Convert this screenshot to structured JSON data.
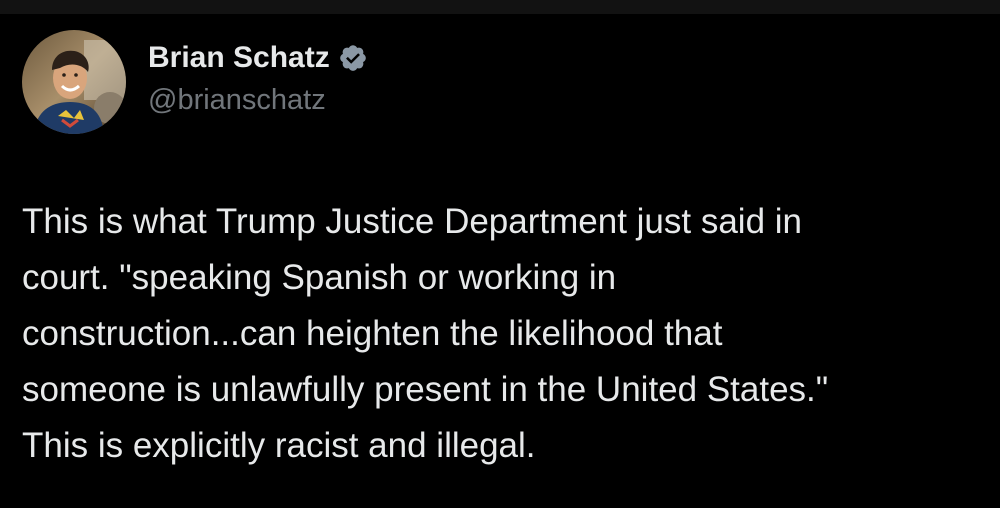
{
  "author": {
    "display_name": "Brian Schatz",
    "handle": "@brianschatz",
    "verified": true,
    "verified_color": "#8b98a5"
  },
  "tweet": {
    "text": "This is what Trump Justice Department just said in\ncourt.  \"speaking Spanish or working in\nconstruction...can heighten the likelihood that\nsomeone is unlawfully present in the United States.\"\nThis is explicitly racist and illegal."
  },
  "icons": {
    "verified": "verified-badge-icon",
    "avatar": "profile-photo"
  },
  "colors": {
    "background": "#000000",
    "text_primary": "#e7e9ea",
    "text_secondary": "#71767b"
  }
}
